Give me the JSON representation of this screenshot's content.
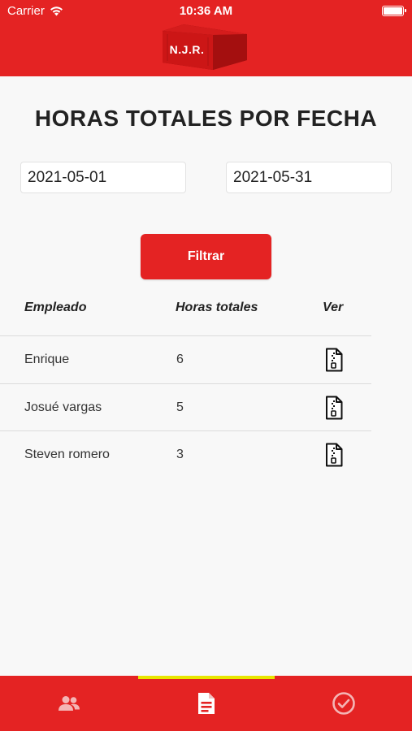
{
  "status_bar": {
    "carrier": "Carrier",
    "time": "10:36 AM"
  },
  "header": {
    "logo_text": "N.J.R."
  },
  "page": {
    "title": "HORAS TOTALES POR FECHA"
  },
  "filters": {
    "date_from": "2021-05-01",
    "date_to": "2021-05-31",
    "button_label": "Filtrar"
  },
  "table": {
    "headers": [
      "Empleado",
      "Horas totales",
      "Ver"
    ],
    "rows": [
      {
        "employee": "Enrique",
        "hours": "6",
        "icon": "zip-file-icon"
      },
      {
        "employee": "Josué vargas",
        "hours": "5",
        "icon": "zip-file-icon"
      },
      {
        "employee": "Steven romero",
        "hours": "3",
        "icon": "zip-file-icon"
      }
    ]
  },
  "bottom_nav": {
    "tabs": [
      {
        "icon": "people-icon"
      },
      {
        "icon": "document-icon",
        "active": true
      },
      {
        "icon": "check-circle-icon"
      }
    ]
  },
  "colors": {
    "brand_red": "#e42323",
    "active_tab_indicator": "#e8e600"
  }
}
